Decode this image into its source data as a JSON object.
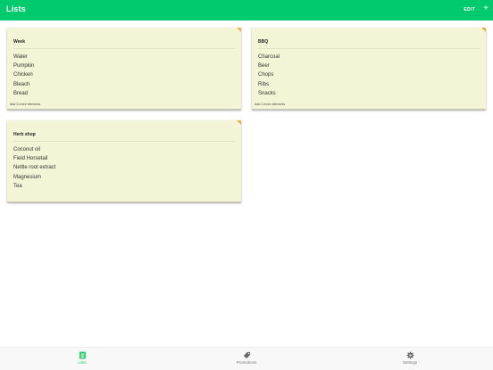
{
  "header": {
    "title": "Lists",
    "edit_label": "EDIT",
    "add_label": "+"
  },
  "colors": {
    "brand": "#00c96e",
    "card": "#f4f4d6",
    "corner": "#e3b64a",
    "active_tab": "#2ecc71"
  },
  "lists": [
    {
      "title": "Week",
      "items": [
        "Water",
        "Pumpkin",
        "Chicken",
        "Bleach",
        "Bread"
      ],
      "more": "Add 3 more elements"
    },
    {
      "title": "BBQ",
      "items": [
        "Charcoal",
        "Beer",
        "Chops",
        "Ribs",
        "Snacks"
      ],
      "more": "Add 1 more elements"
    },
    {
      "title": "Herb shop",
      "items": [
        "Coconut oil",
        "Field Horsetail",
        "Nettle root extract",
        "Magnesium",
        "Tea"
      ],
      "more": ""
    }
  ],
  "tabs": [
    {
      "label": "Lists",
      "icon": "list-icon",
      "active": true
    },
    {
      "label": "Promotions",
      "icon": "tag-icon",
      "active": false
    },
    {
      "label": "Settings",
      "icon": "gear-icon",
      "active": false
    }
  ]
}
